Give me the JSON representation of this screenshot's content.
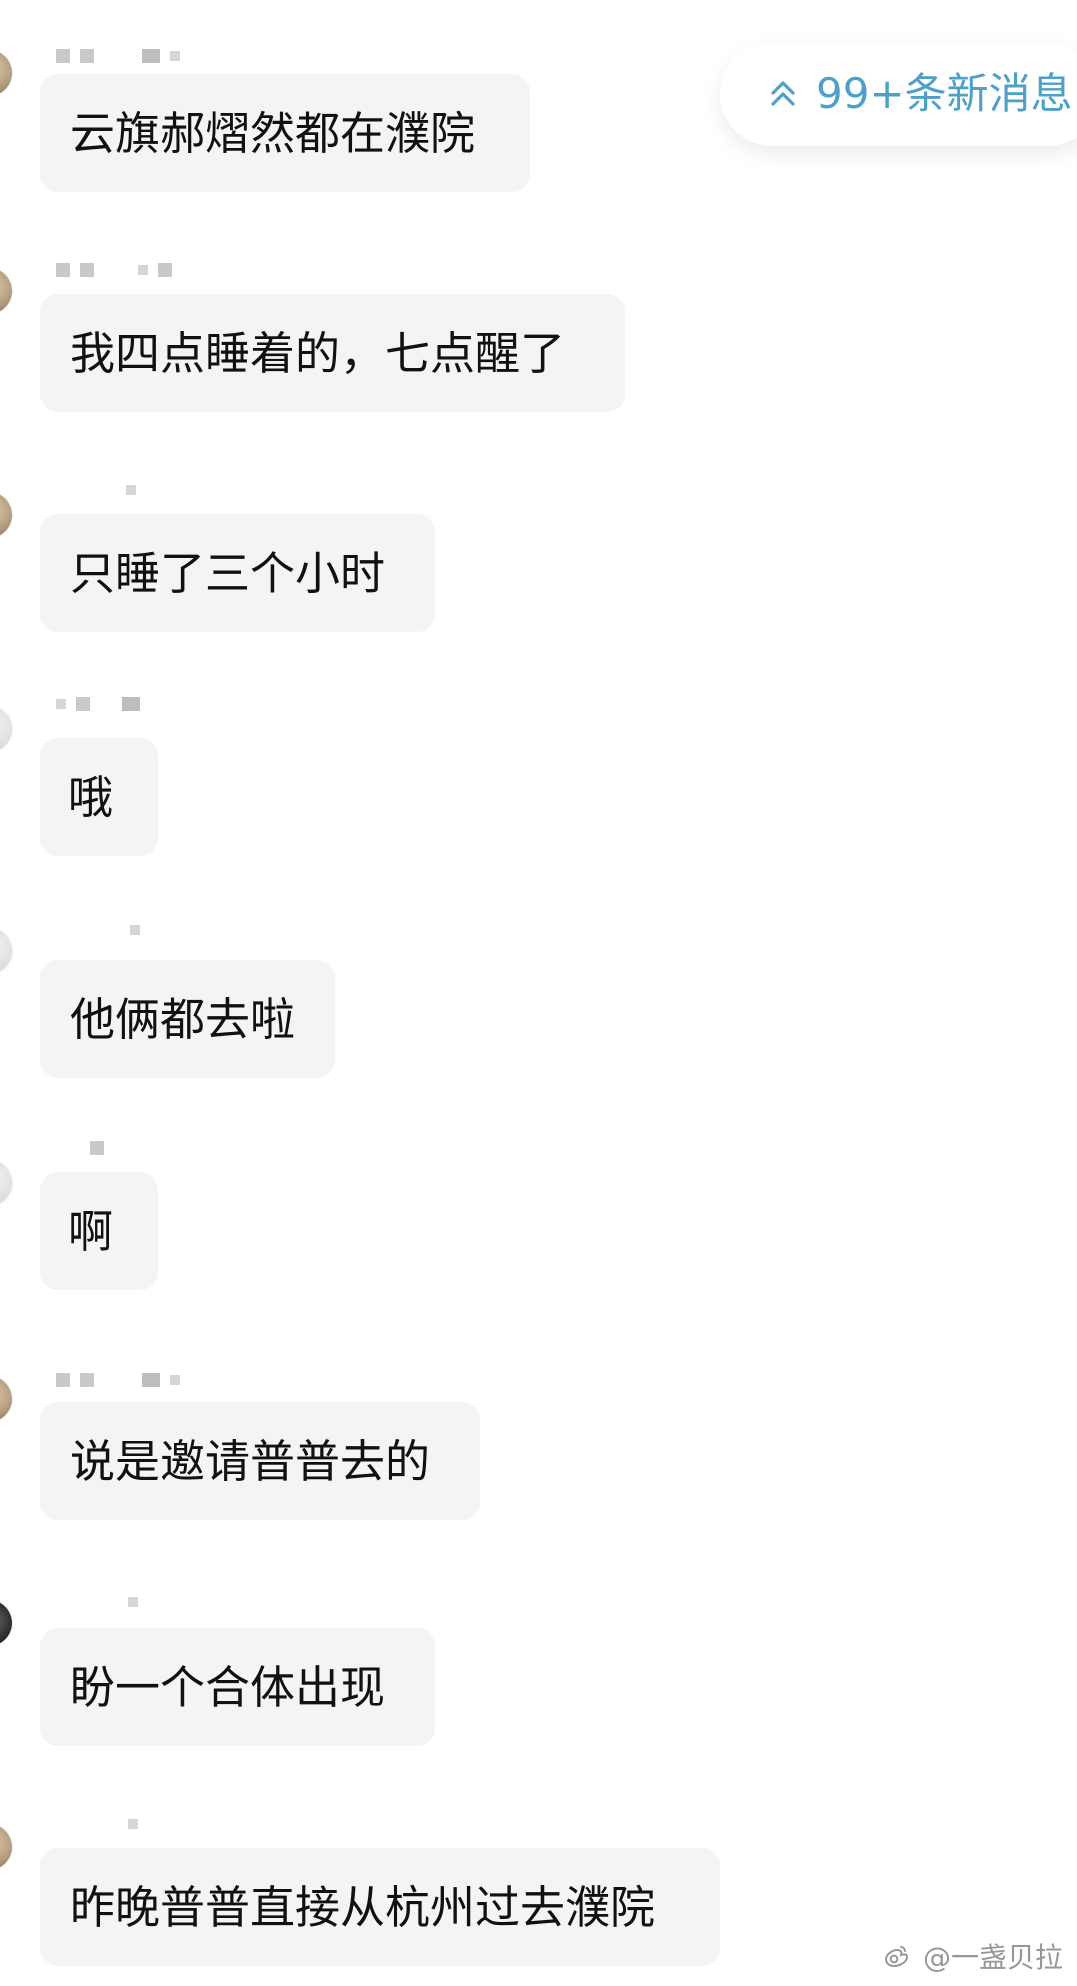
{
  "chat": {
    "new_messages_indicator": {
      "label": "99+条新消息",
      "icon": "double-chevron-up-icon",
      "color": "#4fa0c9"
    },
    "messages": [
      {
        "text": "云旗郝熠然都在濮院"
      },
      {
        "text": "我四点睡着的，七点醒了"
      },
      {
        "text": "只睡了三个小时"
      },
      {
        "text": "哦"
      },
      {
        "text": "他俩都去啦"
      },
      {
        "text": "啊"
      },
      {
        "text": "说是邀请普普去的"
      },
      {
        "text": "盼一个合体出现"
      },
      {
        "text": "昨晚普普直接从杭州过去濮院"
      }
    ]
  },
  "watermark": {
    "text": "@一盏贝拉",
    "icon": "weibo-icon"
  }
}
